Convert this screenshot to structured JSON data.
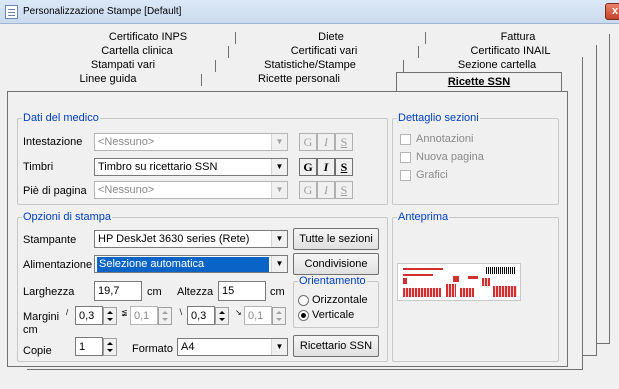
{
  "window": {
    "title": "Personalizzazione Stampe [Default]",
    "close_label": "x"
  },
  "tabs": {
    "row1": [
      "Certificato INPS",
      "Diete",
      "Fattura"
    ],
    "row2": [
      "Cartella clinica",
      "Certificati vari",
      "Certificato INAIL"
    ],
    "row3": [
      "Stampati vari",
      "Statistiche/Stampe",
      "Sezione cartella"
    ],
    "row4": [
      "Linee guida",
      "Ricette personali"
    ],
    "active": "Ricette SSN"
  },
  "dati_medico": {
    "title": "Dati del medico",
    "intestazione_label": "Intestazione",
    "intestazione_value": "<Nessuno>",
    "timbri_label": "Timbri",
    "timbri_value": "Timbro su ricettario SSN",
    "piede_label": "Piè di pagina",
    "piede_value": "<Nessuno>",
    "fmt_g": "G",
    "fmt_i": "I",
    "fmt_s": "S"
  },
  "dettaglio": {
    "title": "Dettaglio sezioni",
    "items": [
      "Annotazioni",
      "Nuova pagina",
      "Grafici"
    ]
  },
  "opzioni": {
    "title": "Opzioni di stampa",
    "stampante_label": "Stampante",
    "stampante_value": "HP DeskJet 3630 series (Rete)",
    "tutte_sezioni": "Tutte le sezioni",
    "alimentazione_label": "Alimentazione",
    "alimentazione_value": "Selezione automatica",
    "condivisione": "Condivisione",
    "larghezza_label": "Larghezza",
    "larghezza_value": "19,7",
    "unit_cm": "cm",
    "altezza_label": "Altezza",
    "altezza_value": "15",
    "margini_label": "Margini",
    "margini_unit": "cm",
    "margini_values": [
      "0,3",
      "0,1",
      "0,3",
      "0,1"
    ],
    "copie_label": "Copie",
    "copie_value": "1",
    "formato_label": "Formato",
    "formato_value": "A4",
    "ricettario_ssn": "Ricettario SSN"
  },
  "orientamento": {
    "title": "Orientamento",
    "orizzontale": "Orizzontale",
    "verticale": "Verticale",
    "selected": "Verticale"
  },
  "anteprima": {
    "title": "Anteprima"
  },
  "colors": {
    "group_title": "#0040c0",
    "selection": "#0a64c8",
    "preview_red": "#d23030"
  }
}
